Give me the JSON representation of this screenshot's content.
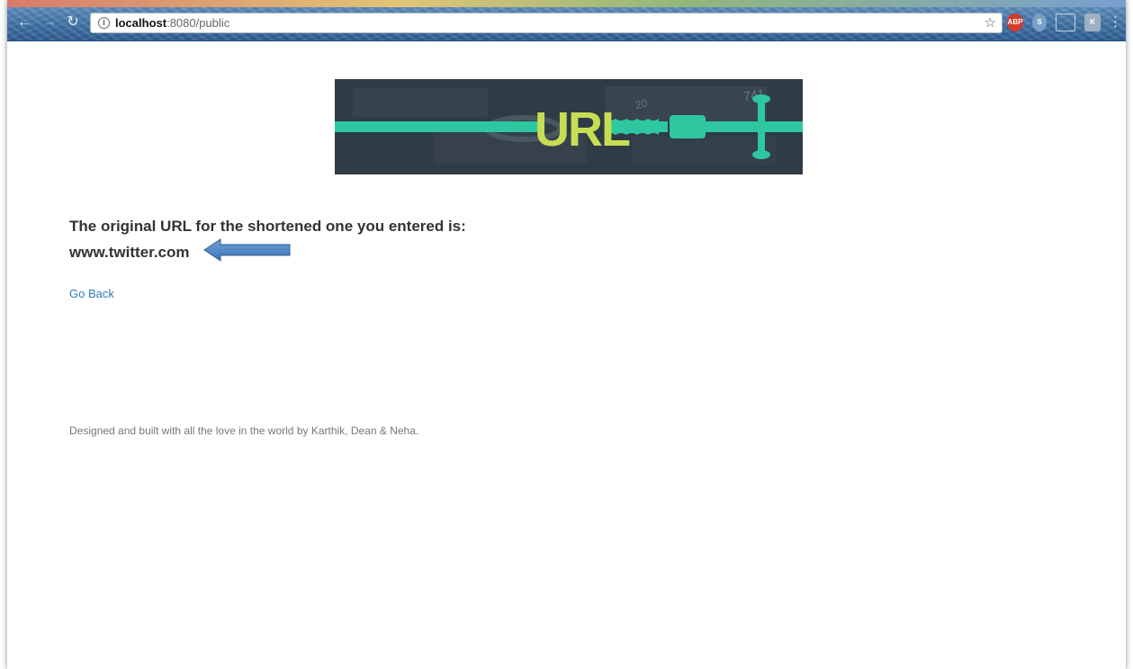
{
  "browser": {
    "url_host": "localhost",
    "url_path": ":8080/public",
    "extensions": {
      "abp": "ABP",
      "s": "S",
      "k": "K"
    }
  },
  "banner": {
    "logo_text": "URL",
    "background_numbers": [
      "20",
      "741"
    ]
  },
  "result": {
    "headline": "The original URL for the shortened one you entered is:",
    "original_url": "www.twitter.com"
  },
  "links": {
    "go_back": "Go Back"
  },
  "footer": {
    "credit": "Designed and built with all the love in the world by Karthik, Dean & Neha."
  },
  "colors": {
    "link": "#337ab7",
    "banner_teal": "#2ec7a0",
    "banner_logo": "#c6dd54",
    "arrow_fill": "#4d86c4"
  }
}
